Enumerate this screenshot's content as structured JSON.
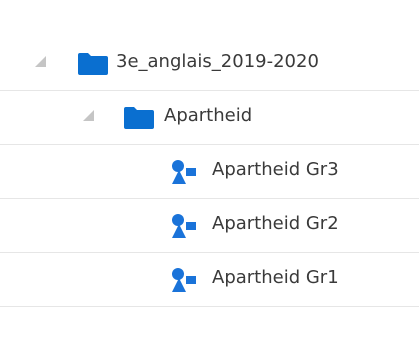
{
  "tree": {
    "root": {
      "label": "3e_anglais_2019-2020",
      "icon": "folder-icon"
    },
    "folder": {
      "label": "Apartheid",
      "icon": "folder-icon"
    },
    "groups": [
      {
        "label": "Apartheid Gr3",
        "icon": "group-icon"
      },
      {
        "label": "Apartheid Gr2",
        "icon": "group-icon"
      },
      {
        "label": "Apartheid Gr1",
        "icon": "group-icon"
      }
    ]
  },
  "colors": {
    "folder": "#0a6fd0",
    "group_icon": "#1a73d9",
    "toggle": "#c5c5c5",
    "separator": "#e6e6e6",
    "text": "#3a3a3a"
  }
}
